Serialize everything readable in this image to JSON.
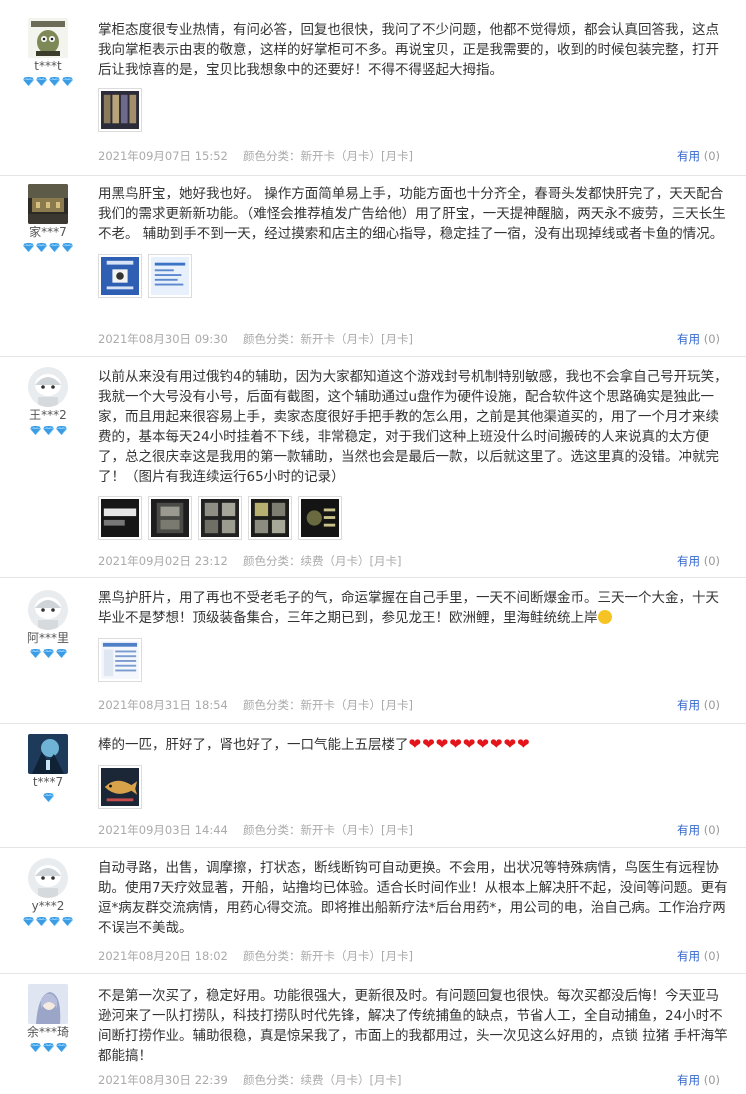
{
  "reviews": [
    {
      "username": "t***t",
      "gems": 4,
      "text": "掌柜态度很专业热情，有问必答，回复也很快，我问了不少问题，他都不觉得烦，都会认真回答我，这点我向掌柜表示由衷的敬意，这样的好掌柜可不多。再说宝贝，正是我需要的，收到的时候包装完整，打开后让我惊喜的是，宝贝比我想象中的还要好！不得不得竖起大拇指。",
      "date": "2021年09月07日 15:52",
      "sku": "颜色分类：新开卡（月卡）[月卡]",
      "useful_label": "有用",
      "useful_count": "(0)"
    },
    {
      "username": "家***7",
      "gems": 4,
      "text": "用黑鸟肝宝，她好我也好。 操作方面简单易上手，功能方面也十分齐全，春哥头发都快肝完了，天天配合我们的需求更新新功能。（难怪会推荐植发广告给他）用了肝宝，一天提神醒脑，两天永不疲劳，三天长生不老。 辅助到手不到一天，经过摸索和店主的细心指导，稳定挂了一宿，没有出现掉线或者卡鱼的情况。",
      "date": "2021年08月30日 09:30",
      "sku": "颜色分类：新开卡（月卡）[月卡]",
      "useful_label": "有用",
      "useful_count": "(0)"
    },
    {
      "username": "王***2",
      "gems": 3,
      "text": "以前从来没有用过俄钓4的辅助，因为大家都知道这个游戏封号机制特别敏感，我也不会拿自己号开玩笑，我就一个大号没有小号，后面有截图，这个辅助通过u盘作为硬件设施，配合软件这个思路确实是独此一家，而且用起来很容易上手，卖家态度很好手把手教的怎么用，之前是其他渠道买的，用了一个月才来续费的，基本每天24小时挂着不下线，非常稳定，对于我们这种上班没什么时间搬砖的人来说真的太方便了，总之很庆幸这是我用的第一款辅助，当然也会是最后一款，以后就这里了。选这里真的没错。冲就完了！（图片有我连续运行65小时的记录）",
      "date": "2021年09月02日 23:12",
      "sku": "颜色分类：续费（月卡）[月卡]",
      "useful_label": "有用",
      "useful_count": "(0)"
    },
    {
      "username": "阿***里",
      "gems": 3,
      "text": "黑鸟护肝片，用了再也不受老毛子的气，命运掌握在自己手里，一天不间断爆金币。三天一个大金，十天毕业不是梦想！顶级装备集合，三年之期已到，参见龙王！欧洲鲤，里海鲑统统上岸",
      "date": "2021年08月31日 18:54",
      "sku": "颜色分类：新开卡（月卡）[月卡]",
      "useful_label": "有用",
      "useful_count": "(0)"
    },
    {
      "username": "t***7",
      "gems": 1,
      "text": "棒的一匹，肝好了，肾也好了，一口气能上五层楼了",
      "hearts": "❤❤❤❤❤❤❤❤❤",
      "date": "2021年09月03日 14:44",
      "sku": "颜色分类：新开卡（月卡）[月卡]",
      "useful_label": "有用",
      "useful_count": "(0)"
    },
    {
      "username": "y***2",
      "gems": 4,
      "text": "自动寻路，出售，调摩擦，打状态，断线断钩可自动更换。不会用，出状况等特殊病情，鸟医生有远程协助。使用7天疗效显著，开船，站撸均已体验。适合长时间作业！从根本上解决肝不起，没间等问题。更有逗*病友群交流病情，用药心得交流。即将推出船新疗法*后台用药*，用公司的电，治自己病。工作治疗两不误岂不美哉。",
      "date": "2021年08月20日 18:02",
      "sku": "颜色分类：新开卡（月卡）[月卡]",
      "useful_label": "有用",
      "useful_count": "(0)"
    },
    {
      "username": "余***琦",
      "gems": 3,
      "text": "不是第一次买了，稳定好用。功能很强大，更新很及时。有问题回复也很快。每次买都没后悔！今天亚马逊河来了一队打捞队，科技打捞队时代先锋，解决了传统捕鱼的缺点，节省人工，全自动捕鱼，24小时不间断打捞作业。辅助很稳，真是惊呆我了，市面上的我都用过，头一次见这么好用的，点锁 拉猪 手杆海竿都能搞！",
      "date": "2021年08月30日 22:39",
      "sku": "颜色分类：续费（月卡）[月卡]",
      "useful_label": "有用",
      "useful_count": "(0)"
    }
  ]
}
